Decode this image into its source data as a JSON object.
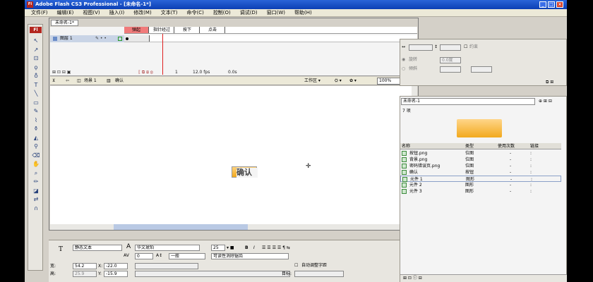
{
  "window": {
    "title": "Adobe Flash CS3 Professional - [未命名-1*]"
  },
  "menu": [
    "文件(F)",
    "编辑(E)",
    "视图(V)",
    "插入(I)",
    "修改(M)",
    "文本(T)",
    "命令(C)",
    "控制(O)",
    "调试(D)",
    "窗口(W)",
    "帮助(H)"
  ],
  "toolbox": {
    "logo": "Fl",
    "tools": [
      {
        "icon": "selection-tool-icon",
        "glyph": "↖"
      },
      {
        "icon": "subselection-tool-icon",
        "glyph": "↗"
      },
      {
        "icon": "free-transform-icon",
        "glyph": "⊡"
      },
      {
        "icon": "lasso-icon",
        "glyph": "ϙ"
      },
      {
        "icon": "pen-icon",
        "glyph": "♁"
      },
      {
        "icon": "text-tool-icon",
        "glyph": "T"
      },
      {
        "icon": "line-tool-icon",
        "glyph": "╲"
      },
      {
        "icon": "rectangle-tool-icon",
        "glyph": "▭"
      },
      {
        "icon": "pencil-icon",
        "glyph": "✎"
      },
      {
        "icon": "brush-icon",
        "glyph": "⌇"
      },
      {
        "icon": "ink-bottle-icon",
        "glyph": "⚱"
      },
      {
        "icon": "paint-bucket-icon",
        "glyph": "◭"
      },
      {
        "icon": "eyedropper-icon",
        "glyph": "⚲"
      },
      {
        "icon": "eraser-icon",
        "glyph": "⌫"
      },
      {
        "icon": "hand-icon",
        "glyph": "✋"
      },
      {
        "icon": "zoom-icon",
        "glyph": "⌕"
      },
      {
        "icon": "stroke-color-icon",
        "glyph": "✏"
      },
      {
        "icon": "fill-color-icon",
        "glyph": "◪"
      },
      {
        "icon": "swap-colors-icon",
        "glyph": "⇄"
      },
      {
        "icon": "snap-icon",
        "glyph": "∩"
      }
    ]
  },
  "document": {
    "tab": "未命名-1*",
    "timeline": {
      "layer": "图层 1",
      "states": [
        {
          "label": "弹起",
          "active": true
        },
        {
          "label": "指针经过",
          "active": false
        },
        {
          "label": "按下",
          "active": false
        },
        {
          "label": "点击",
          "active": false
        }
      ],
      "status": {
        "frame": "1",
        "fps": "12.0 fps",
        "time": "0.0s"
      }
    },
    "editbar": {
      "scene": "场景 1",
      "symbol": "确认",
      "workspace": "工作区 ▾",
      "zoom": "100%"
    },
    "stage_button_text": "确认"
  },
  "properties": {
    "type_icon": "T",
    "text_type": "静态文本",
    "font": "华文琥珀",
    "size": "25",
    "bold": "B",
    "italic": "I",
    "letter_spacing": "0",
    "baseline": "一般",
    "antialias": "可读性消除锯齿",
    "w_label": "宽:",
    "w": "54.2",
    "x_label": "X:",
    "x": "-22.0",
    "h_label": "高:",
    "h": "25.9",
    "y_label": "Y:",
    "y": "-15.9",
    "auto_kern": "自动调整字距",
    "target_label": "目标:"
  },
  "transform": {
    "constrain": "约束",
    "rotate": "旋转",
    "rotate_value": "0.0度",
    "skew": "倾斜"
  },
  "library": {
    "doc": "未命名-1",
    "count": "7 项",
    "columns": [
      "名称",
      "类型",
      "使用次数",
      "链接"
    ],
    "items": [
      {
        "name": "按钮.png",
        "type": "位图",
        "uses": "-",
        "link": ":"
      },
      {
        "name": "背景.png",
        "type": "位图",
        "uses": "-",
        "link": ":"
      },
      {
        "name": "密码错误页.png",
        "type": "位图",
        "uses": "-",
        "link": ":"
      },
      {
        "name": "确认",
        "type": "按钮",
        "uses": "-",
        "link": ":"
      },
      {
        "name": "元件 1",
        "type": "图形",
        "uses": "-",
        "link": ":"
      },
      {
        "name": "元件 2",
        "type": "图形",
        "uses": "-",
        "link": ":"
      },
      {
        "name": "元件 3",
        "type": "图形",
        "uses": "-",
        "link": ":"
      }
    ]
  }
}
